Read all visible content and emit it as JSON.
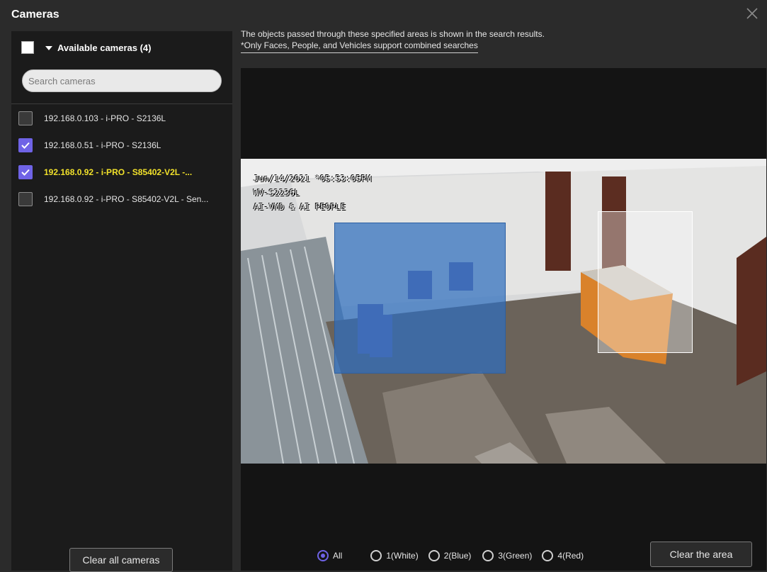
{
  "window": {
    "title": "Cameras",
    "close_icon": "close-icon"
  },
  "sidebar": {
    "master_checked": false,
    "available_label": "Available cameras (4)",
    "search_placeholder": "Search cameras",
    "cameras": [
      {
        "label": "192.168.0.103 - i-PRO - S2136L",
        "checked": false,
        "highlighted": false
      },
      {
        "label": "192.168.0.51 - i-PRO - S2136L",
        "checked": true,
        "highlighted": false
      },
      {
        "label": "192.168.0.92 - i-PRO - S85402-V2L -...",
        "checked": true,
        "highlighted": true
      },
      {
        "label": "192.168.0.92 - i-PRO - S85402-V2L - Sen...",
        "checked": false,
        "highlighted": false
      }
    ],
    "clear_button": "Clear all cameras"
  },
  "info": {
    "line1": "The objects passed through these specified areas is shown in the search results.",
    "line2": "*Only Faces, People, and Vehicles support combined searches"
  },
  "video": {
    "overlay_line1": "Jun/14/2021 *05:53:05PM",
    "overlay_line2": "WV-S2236L",
    "overlay_line3": "AI-VMD & AI PEOPLE"
  },
  "areas": {
    "options": [
      {
        "label": "All",
        "selected": true
      },
      {
        "label": "1(White)",
        "selected": false
      },
      {
        "label": "2(Blue)",
        "selected": false
      },
      {
        "label": "3(Green)",
        "selected": false
      },
      {
        "label": "4(Red)",
        "selected": false
      }
    ],
    "clear_button": "Clear the area"
  },
  "colors": {
    "accent": "#6f63e6",
    "highlight_text": "#f1e12a",
    "area_blue": "#2e6ebe",
    "area_white": "#ffffff"
  }
}
